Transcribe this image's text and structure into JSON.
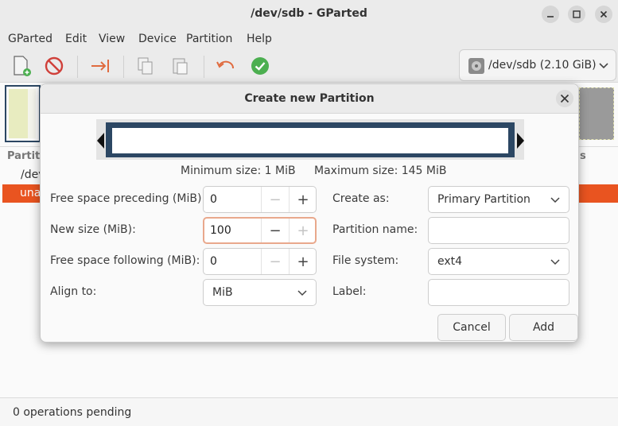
{
  "window": {
    "title": "/dev/sdb - GParted"
  },
  "menu": [
    "GParted",
    "Edit",
    "View",
    "Device",
    "Partition",
    "Help"
  ],
  "device_selector": {
    "label": "/dev/sdb (2.10 GiB)"
  },
  "background": {
    "partition_header": "Partit",
    "row_path": "/dev",
    "row_unallocated": "una",
    "right_header": "s"
  },
  "status": {
    "text": "0 operations pending"
  },
  "dialog": {
    "title": "Create new Partition",
    "min_size": "Minimum size: 1 MiB",
    "max_size": "Maximum size: 145 MiB",
    "free_preceding": {
      "label": "Free space preceding (MiB):",
      "value": "0"
    },
    "new_size": {
      "label": "New size (MiB):",
      "value": "100"
    },
    "free_following": {
      "label": "Free space following (MiB):",
      "value": "0"
    },
    "align_to": {
      "label": "Align to:",
      "value": "MiB"
    },
    "create_as": {
      "label": "Create as:",
      "value": "Primary Partition"
    },
    "partition_name": {
      "label": "Partition name:",
      "value": ""
    },
    "file_system": {
      "label": "File system:",
      "value": "ext4"
    },
    "fs_label": {
      "label": "Label:",
      "value": ""
    },
    "cancel_label": "Cancel",
    "add_label": "Add"
  },
  "colors": {
    "accent": "#e95420",
    "frame": "#2c4763",
    "focus": "#e9a88c"
  }
}
